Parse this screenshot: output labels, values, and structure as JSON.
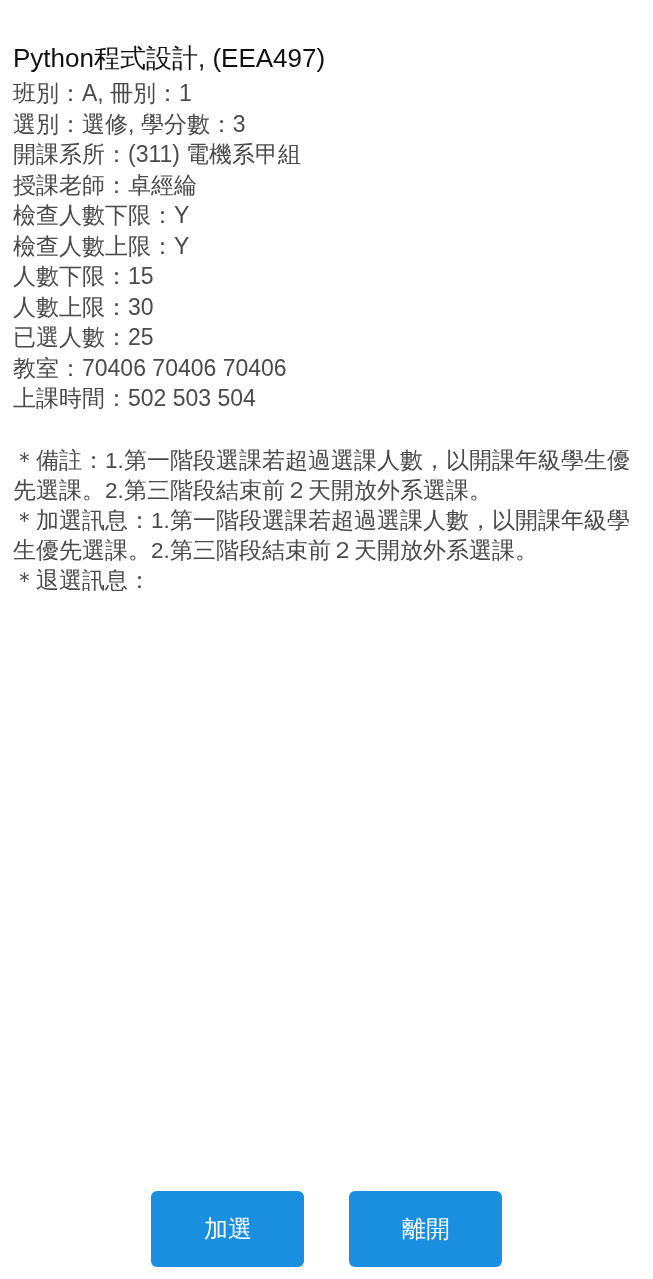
{
  "title": "Python程式設計, (EEA497)",
  "details": [
    "班別：A, 冊別：1",
    "選別：選修, 學分數：3",
    "開課系所：(311) 電機系甲組",
    "授課老師：卓經綸",
    "檢查人數下限：Y",
    "檢查人數上限：Y",
    "人數下限：15",
    "人數上限：30",
    "已選人數：25",
    "教室：70406 70406 70406",
    "上課時間：502 503 504"
  ],
  "notes": [
    "＊備註：1.第一階段選課若超過選課人數，以開課年級學生優先選課。2.第三階段結束前２天開放外系選課。",
    "＊加選訊息：1.第一階段選課若超過選課人數，以開課年級學生優先選課。2.第三階段結束前２天開放外系選課。",
    "＊退選訊息："
  ],
  "buttons": [
    "加選",
    "離開"
  ]
}
